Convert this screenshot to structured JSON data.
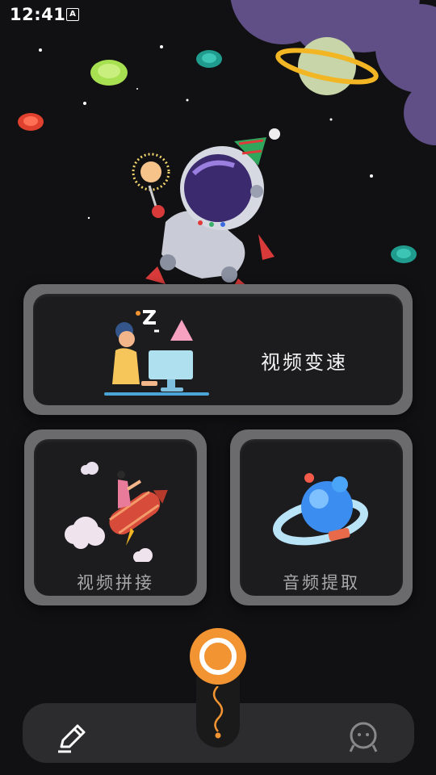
{
  "status_bar": {
    "time": "12:41",
    "keyboard_badge": "A"
  },
  "cards": {
    "speed": {
      "label": "视频变速"
    },
    "join": {
      "label": "视频拼接"
    },
    "extract": {
      "label": "音频提取"
    }
  },
  "nav": {
    "left_icon": "pen-icon",
    "center_icon": "record-icon",
    "right_icon": "robot-face-icon"
  },
  "colors": {
    "accent": "#f29432",
    "card_frame": "#6b6b6d",
    "card_inner": "#1c1c1e",
    "background": "#111113"
  }
}
